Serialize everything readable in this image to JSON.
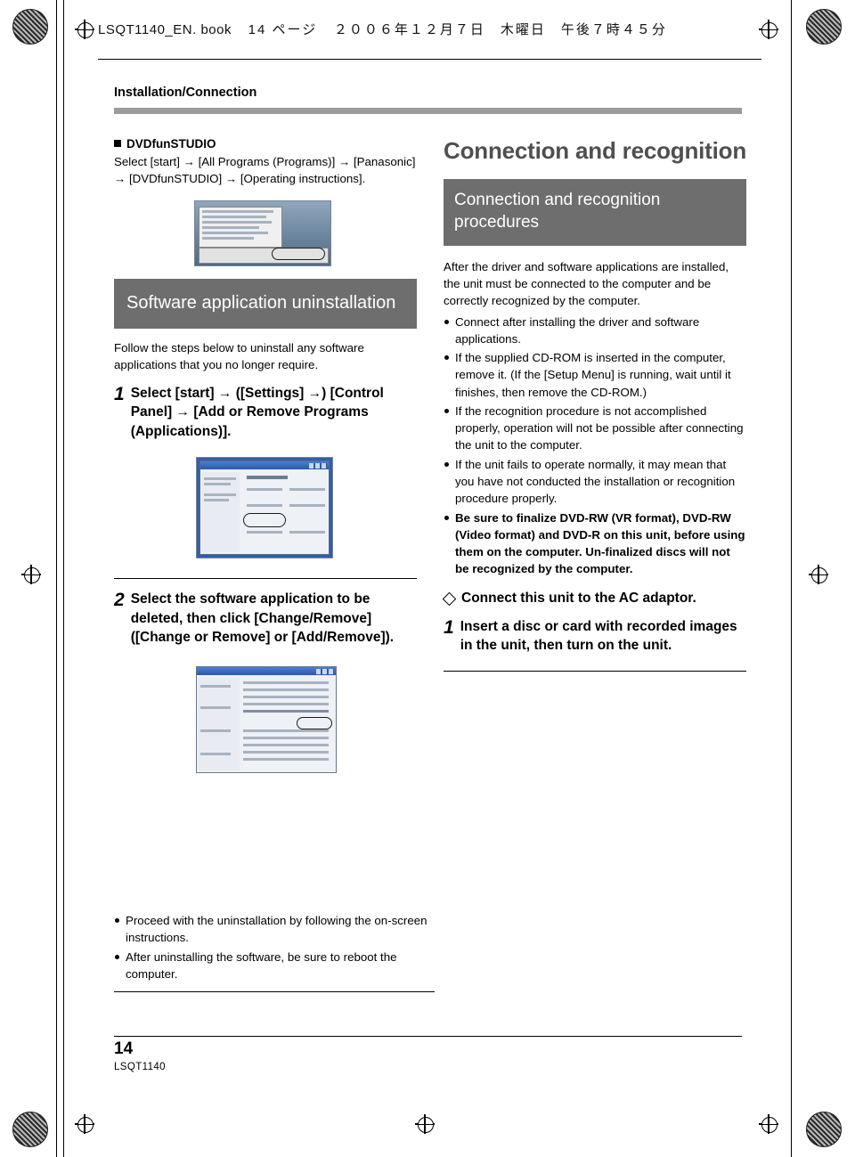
{
  "header": {
    "filename": "LSQT1140_EN. book",
    "page_info": "14 ページ",
    "date_jp": "２００６年１２月７日　木曜日　午後７時４５分"
  },
  "section": {
    "title": "Installation/Connection"
  },
  "left": {
    "dvdfunstudio_heading": "DVDfunSTUDIO",
    "dvdfunstudio_body": "Select [start] → [All Programs (Programs)] → [Panasonic] → [DVDfunSTUDIO] → [Operating instructions].",
    "uninstall_title": "Software application uninstallation",
    "uninstall_lead": "Follow the steps below to uninstall any software applications that you no longer require.",
    "steps": [
      {
        "num": "1",
        "text": "Select [start] → ([Settings] →) [Control Panel] → [Add or Remove Programs (Applications)]."
      },
      {
        "num": "2",
        "text": "Select the software application to be deleted, then click [Change/Remove] ([Change or Remove] or [Add/Remove])."
      }
    ]
  },
  "right": {
    "title": "Connection and recognition",
    "band_title": "Connection and recognition procedures",
    "intro": "After the driver and software applications are installed, the unit must be connected to the computer and be correctly recognized by the computer.",
    "bullets": [
      {
        "text": "Connect after installing the driver and software applications.",
        "bold": false
      },
      {
        "text": "If the supplied CD-ROM is inserted in the computer, remove it. (If the [Setup Menu] is running, wait until it finishes, then remove the CD-ROM.)",
        "bold": false
      },
      {
        "text": "If the recognition procedure is not accomplished properly, operation will not be possible after connecting the unit to the computer.",
        "bold": false
      },
      {
        "text": "If the unit fails to operate normally, it may mean that you have not conducted the installation or recognition procedure properly.",
        "bold": false
      },
      {
        "text": "Be sure to finalize DVD-RW (VR format), DVD-RW (Video format) and DVD-R on this unit, before using them on the computer. Un-finalized discs will not be recognized by the computer.",
        "bold": true
      }
    ],
    "diamond_note": "Connect this unit to the AC adaptor.",
    "step": {
      "num": "1",
      "text": "Insert a disc or card with recorded images in the unit, then turn on the unit."
    }
  },
  "bottom_notes": [
    "Proceed with the uninstallation by following the on-screen instructions.",
    "After uninstalling the software, be sure to reboot the computer."
  ],
  "footer": {
    "page_number": "14",
    "doc_id": "LSQT1140"
  }
}
